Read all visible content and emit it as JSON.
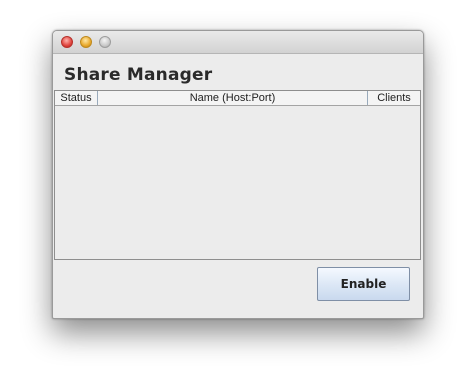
{
  "window": {
    "title": "Share Manager",
    "traffic_lights": [
      "close-icon",
      "minimize-icon",
      "zoom-icon"
    ]
  },
  "table": {
    "columns": [
      "Status",
      "Name (Host:Port)",
      "Clients"
    ],
    "rows": []
  },
  "buttons": {
    "enable_label": "Enable"
  }
}
